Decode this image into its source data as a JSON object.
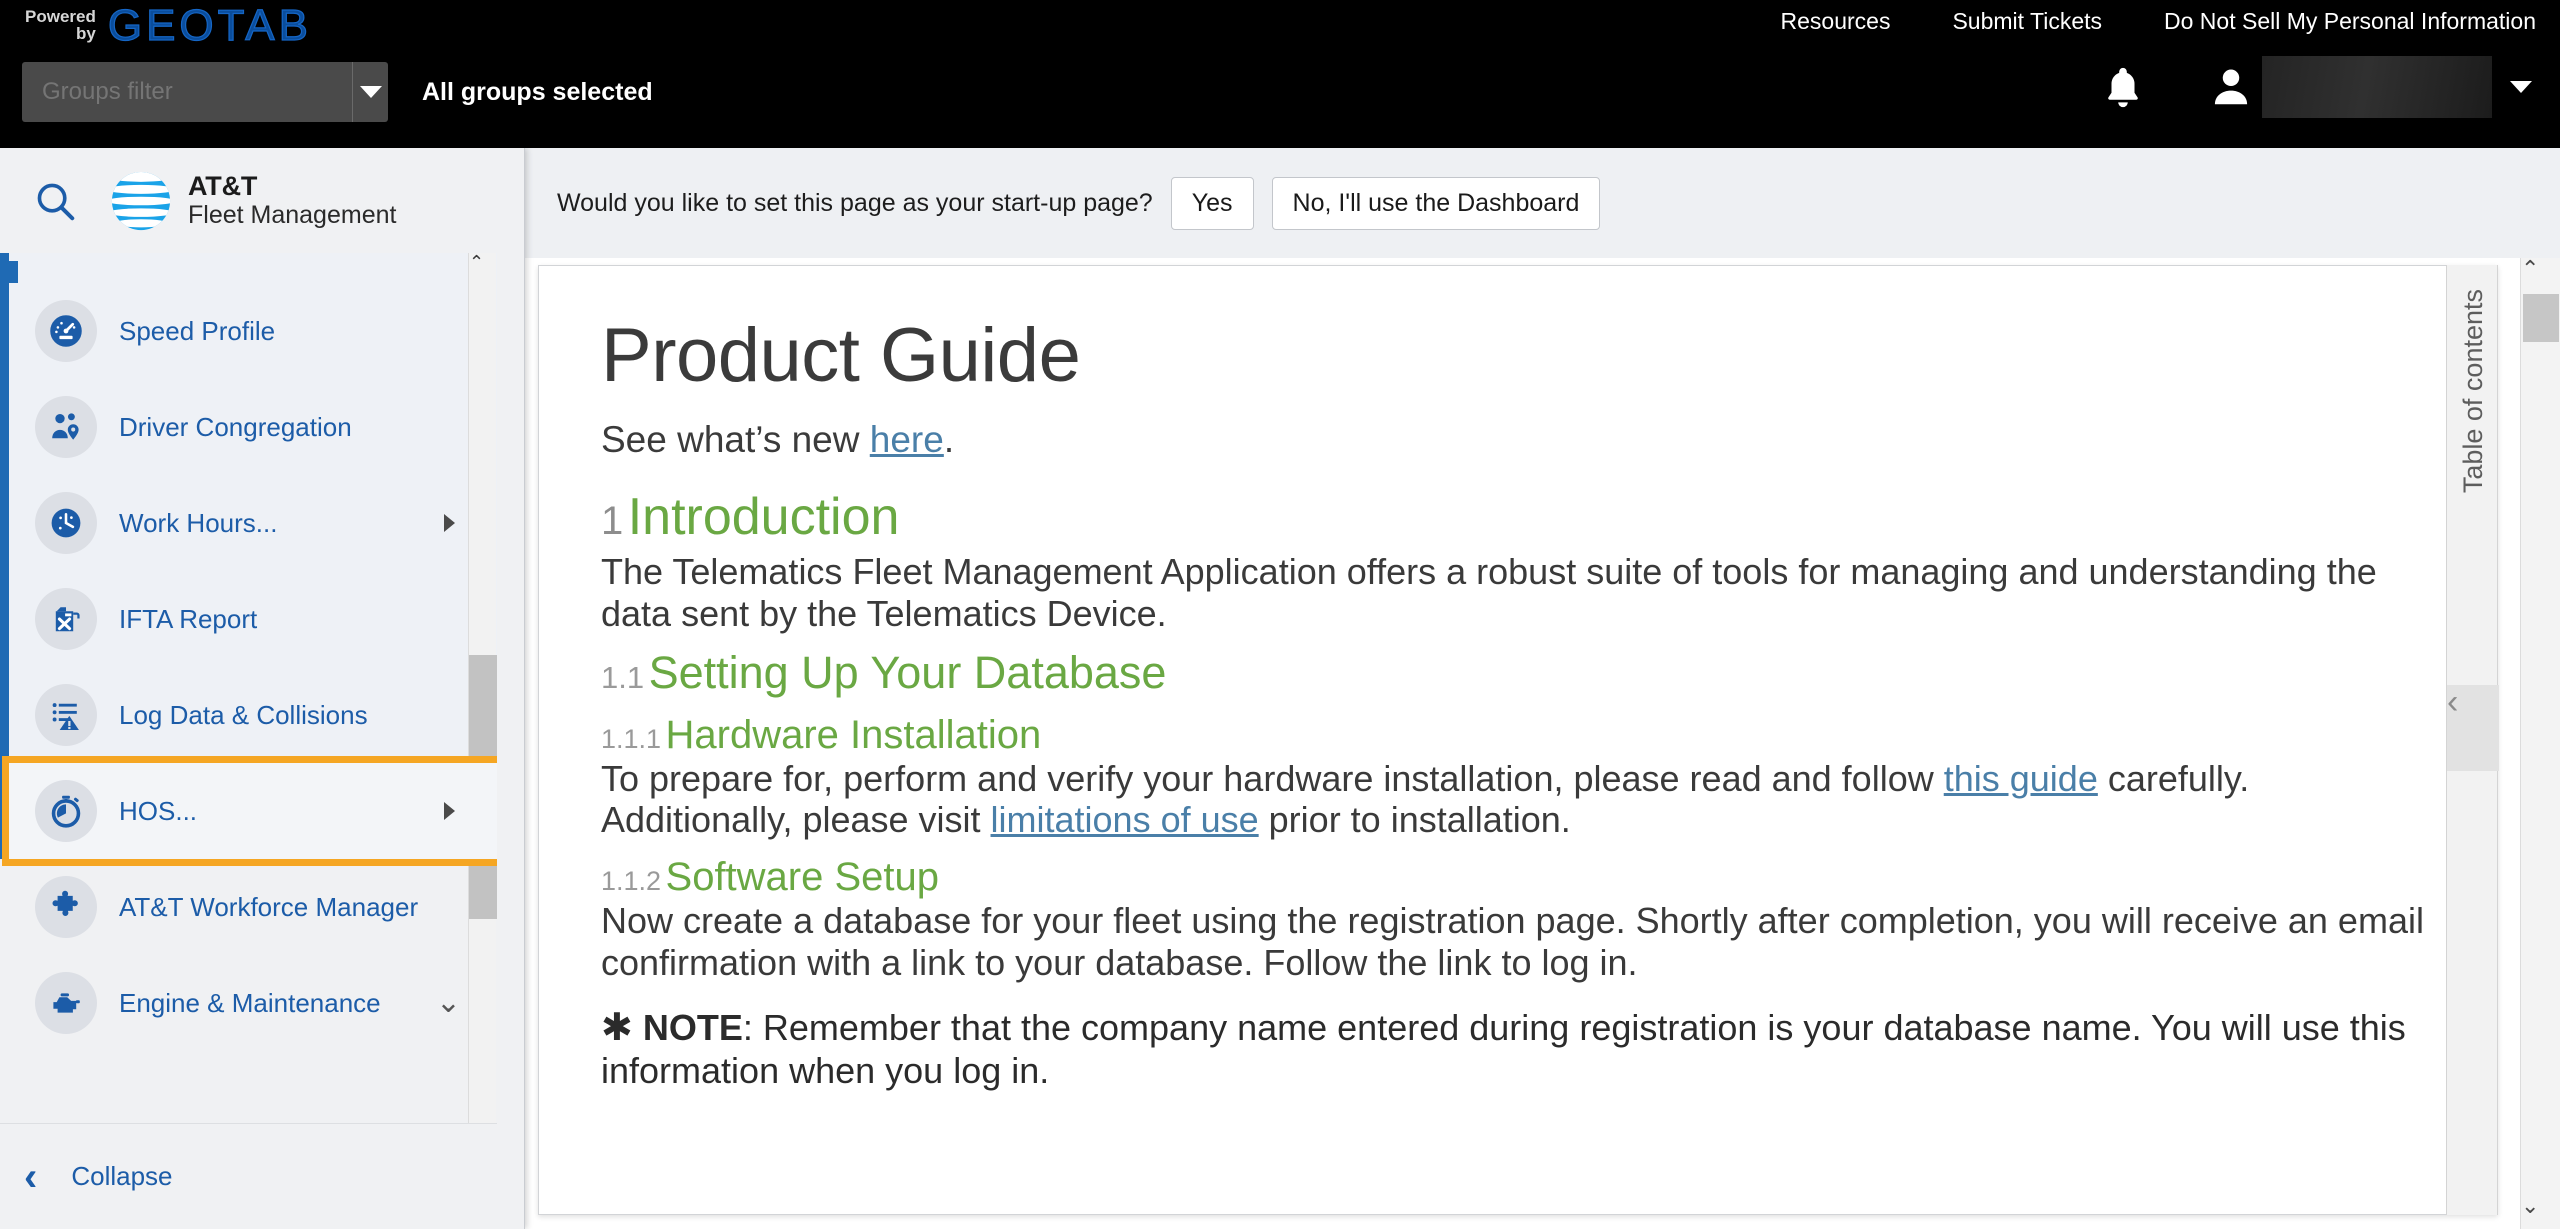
{
  "topbar": {
    "powered_word1": "Powered",
    "powered_word2": "by",
    "brand_logo": "GEOTAB",
    "nav": [
      {
        "label": "Resources"
      },
      {
        "label": "Submit Tickets"
      },
      {
        "label": "Do Not Sell My Personal Information"
      }
    ],
    "groups_filter_placeholder": "Groups filter",
    "groups_status": "All groups selected",
    "icons": {
      "notifications": "bell-icon",
      "user": "person-icon",
      "user_menu_caret": "caret-down-icon"
    },
    "user_name": ""
  },
  "sidebar": {
    "search_icon": "search-icon",
    "brand_line1": "AT&T",
    "brand_line2": "Fleet Management",
    "items": [
      {
        "label": "Speed Profile",
        "icon": "speedometer-icon",
        "arrow": "",
        "group": true,
        "highlighted": false
      },
      {
        "label": "Driver Congregation",
        "icon": "people-pin-icon",
        "arrow": "",
        "group": true,
        "highlighted": false
      },
      {
        "label": "Work Hours...",
        "icon": "clock-icon",
        "arrow": "right",
        "group": true,
        "highlighted": false
      },
      {
        "label": "IFTA Report",
        "icon": "fuel-can-icon",
        "arrow": "",
        "group": true,
        "highlighted": false
      },
      {
        "label": "Log Data & Collisions",
        "icon": "log-alert-icon",
        "arrow": "",
        "group": true,
        "highlighted": false
      },
      {
        "label": "HOS...",
        "icon": "stopwatch-icon",
        "arrow": "right",
        "group": true,
        "highlighted": true
      },
      {
        "label": "AT&T Workforce Manager",
        "icon": "puzzle-icon",
        "arrow": "",
        "group": false,
        "highlighted": false
      },
      {
        "label": "Engine & Maintenance",
        "icon": "engine-icon",
        "arrow": "down",
        "group": false,
        "highlighted": false
      }
    ],
    "collapse_label": "Collapse"
  },
  "banner": {
    "question": "Would you like to set this page as your start-up page?",
    "yes_label": "Yes",
    "no_label": "No, I'll use the Dashboard"
  },
  "document": {
    "title": "Product Guide",
    "lead_before": "See what’s new ",
    "lead_link": "here",
    "lead_after": ".",
    "sections": [
      {
        "num": "1",
        "heading": "Introduction",
        "level": 2,
        "body": "The Telematics Fleet Management Application offers a robust suite of tools for managing and understanding the data sent by the Telematics Device."
      },
      {
        "num": "1.1",
        "heading": "Setting Up Your Database",
        "level": 3,
        "body": ""
      },
      {
        "num": "1.1.1",
        "heading": "Hardware Installation",
        "level": 4,
        "body_p1_a": "To prepare for, perform and verify your hardware installation, please read and follow ",
        "body_p1_link1": "this guide",
        "body_p1_b": " carefully. Additionally, please visit ",
        "body_p1_link2": "limitations of use",
        "body_p1_c": " prior to installation."
      },
      {
        "num": "1.1.2",
        "heading": "Software Setup",
        "level": 4,
        "body": "Now create a database for your fleet using the registration page. Shortly after completion, you will receive an email confirmation with a link to your database. Follow the link to log in.",
        "note_marker": "✱",
        "note_label": "NOTE",
        "note_body": ": Remember that the company name entered during registration is your database name. You will use this information when you log in."
      }
    ]
  },
  "toc": {
    "label": "Table of contents",
    "collapse_icon": "chevron-left-icon"
  },
  "colors": {
    "accent_blue": "#1c5ca8",
    "heading_green": "#6aa843",
    "highlight_orange": "#f5a623",
    "link_blue": "#4a7fa8",
    "topbar_black": "#000000",
    "sidebar_bg": "#f0f1f3"
  }
}
